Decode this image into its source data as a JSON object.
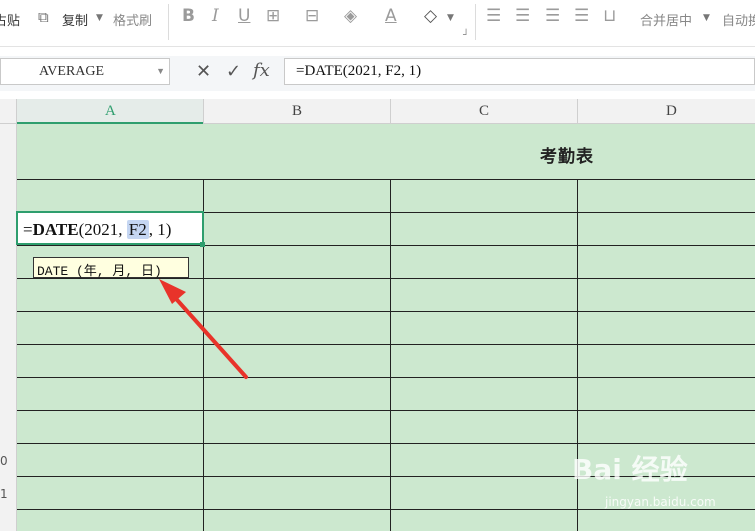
{
  "ribbon": {
    "paste_label": "占贴",
    "copy_label": "复制",
    "format_painter_label": "格式刷",
    "merge_center_label": "合并居中",
    "auto_wrap_label": "自动换"
  },
  "formula_bar": {
    "name_box": "AVERAGE",
    "fx_label": "fx",
    "formula": "=DATE(2021, F2, 1)"
  },
  "columns": [
    "A",
    "B",
    "C",
    "D"
  ],
  "row_numbers": [
    "0",
    "1"
  ],
  "sheet": {
    "title": "考勤表",
    "edit_cell": {
      "prefix": "=",
      "func": "DATE",
      "open": "(2021, ",
      "ref": "F2",
      "close": ", 1)"
    },
    "tooltip": "DATE (年, 月, 日)"
  },
  "watermark": {
    "brand": "Bai 经验",
    "url": "jingyan.baidu.com"
  },
  "colors": {
    "sheet_bg": "#cce8cf",
    "selection": "#2e9e6e",
    "reference_highlight": "#c5d6f2",
    "arrow": "#e8332a"
  }
}
